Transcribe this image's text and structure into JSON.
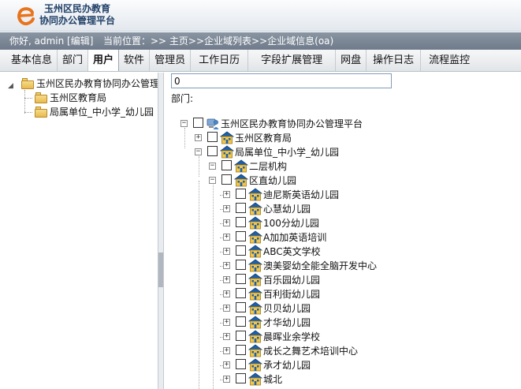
{
  "header": {
    "logo_line1": "玉州区民办教育",
    "logo_line2": "协同办公管理平台"
  },
  "infobar": {
    "greeting": "你好, admin [编辑]",
    "location": "当前位置：>> 主页>>企业域列表>>企业域信息(oa)"
  },
  "tabs": [
    {
      "label": "基本信息"
    },
    {
      "label": "部门"
    },
    {
      "label": "用户"
    },
    {
      "label": "软件"
    },
    {
      "label": "管理员"
    },
    {
      "label": "工作日历"
    },
    {
      "label": "字段扩展管理"
    },
    {
      "label": "网盘"
    },
    {
      "label": "操作日志"
    },
    {
      "label": "流程监控"
    }
  ],
  "active_tab": "用户",
  "left_tree": {
    "root": "玉州区民办教育协同办公管理",
    "children": [
      "玉州区教育局",
      "局属单位_中小学_幼儿园"
    ]
  },
  "form": {
    "id_value": "0",
    "dept_label": "部门:"
  },
  "dept_tree": {
    "root": "玉州区民办教育协同办公管理平台",
    "level1": [
      "玉州区教育局",
      "局属单位_中小学_幼儿园"
    ],
    "level2": [
      "二层机构",
      "区直幼儿园"
    ],
    "level3": [
      "迪尼斯英语幼儿园",
      "心慧幼儿园",
      "100分幼儿园",
      "A加加英语培训",
      "ABC英文学校",
      "澳美婴幼全能全脑开发中心",
      "百乐园幼儿园",
      "百利街幼儿园",
      "贝贝幼儿园",
      "才华幼儿园",
      "晨晖业余学校",
      "成长之舞艺术培训中心",
      "承才幼儿园",
      "城北"
    ]
  },
  "icons": {
    "logo": "e-logo-icon",
    "folder": "folder-icon",
    "root_node": "computer-user-icon",
    "org_node": "building-icon"
  },
  "colors": {
    "logo_orange": "#e8741c",
    "infobar_bg": "#7a8593",
    "building_roof": "#1f5fa8",
    "building_body": "#f2c64a"
  }
}
